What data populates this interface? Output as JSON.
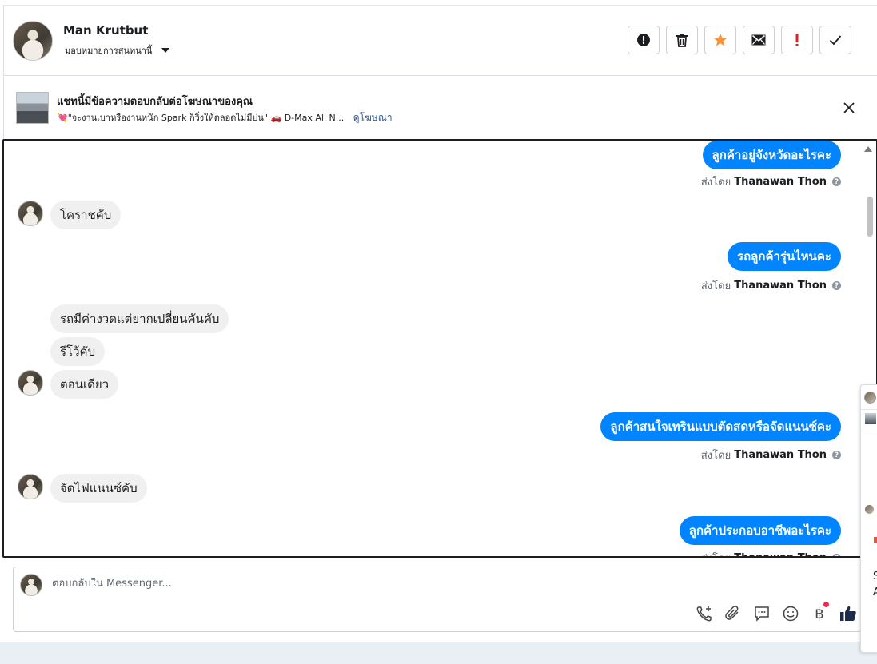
{
  "header": {
    "user_name": "Man Krutbut",
    "assign_label": "มอบหมายการสนทนานี้",
    "tools": [
      {
        "name": "spam-alert-icon"
      },
      {
        "name": "trash-icon"
      },
      {
        "name": "star-icon"
      },
      {
        "name": "mail-icon"
      },
      {
        "name": "exclamation-icon"
      },
      {
        "name": "check-icon"
      }
    ]
  },
  "ad": {
    "title": "แชทนี้มีข้อความตอบกลับต่อโฆษณาของคุณ",
    "subtitle": "💘\"จะงานเบาหรืองานหนัก Spark ก็วิ่งให้ตลอดไม่มีบ่น\" 🚗 D-Max All N...",
    "link": "ดูโฆษณา"
  },
  "chat": {
    "sent_by_prefix": "ส่งโดย",
    "sender": "Thanawan Thon",
    "messages": [
      {
        "dir": "out",
        "text": "ลูกค้าอยู่จังหวัดอะไรคะ"
      },
      {
        "dir": "in",
        "text": "โคราชคับ"
      },
      {
        "dir": "out",
        "text": "รถลูกค้ารุ่นไหนคะ"
      },
      {
        "dir": "in",
        "text": "รถมีค่างวดแต่ยากเปลี่ยนคันคับ"
      },
      {
        "dir": "in",
        "text": "รีโว้คับ"
      },
      {
        "dir": "in",
        "text": "ตอนเดียว"
      },
      {
        "dir": "out",
        "text": "ลูกค้าสนใจเทรินแบบตัดสดหรือจัดแนนซ์คะ"
      },
      {
        "dir": "in",
        "text": "จัดไฟแนนซ์คับ"
      },
      {
        "dir": "out",
        "text": "ลูกค้าประกอบอาชีพอะไรคะ"
      }
    ]
  },
  "reply": {
    "placeholder": "ตอบกลับใน Messenger...",
    "icons": [
      "phone-plus-icon",
      "attachment-icon",
      "chat-bubble-icon",
      "emoji-icon",
      "baht-icon",
      "thumbs-up-icon"
    ],
    "baht_symbol": "฿"
  },
  "side_panel": {
    "text": "S\nA"
  },
  "colors": {
    "brand_blue": "#0084ff",
    "incoming_bg": "#f0f0f0",
    "star": "#f7923a",
    "alert_red": "#e02020"
  }
}
